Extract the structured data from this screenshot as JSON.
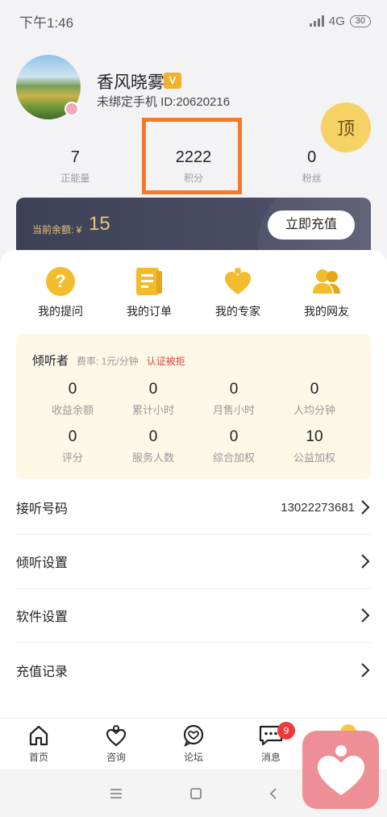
{
  "status_bar": {
    "time": "下午1:46",
    "network": "4G",
    "battery": "30"
  },
  "profile": {
    "name": "香风晓雾",
    "vip_badge": "V",
    "sub_line": "未绑定手机 ID:20620216",
    "top_button": "顶"
  },
  "stats": [
    {
      "value": "7",
      "label": "正能量"
    },
    {
      "value": "2222",
      "label": "积分"
    },
    {
      "value": "0",
      "label": "粉丝"
    }
  ],
  "balance": {
    "label": "当前余额: ¥",
    "value": "15",
    "recharge_button": "立即充值"
  },
  "quick_actions": [
    {
      "label": "我的提问",
      "icon": "question-icon"
    },
    {
      "label": "我的订单",
      "icon": "order-icon"
    },
    {
      "label": "我的专家",
      "icon": "expert-heart-icon"
    },
    {
      "label": "我的网友",
      "icon": "friends-icon"
    }
  ],
  "listener": {
    "title": "倾听者",
    "rate": "费率: 1元/分钟",
    "status": "认证被拒",
    "stats": [
      {
        "value": "0",
        "label": "收益余额"
      },
      {
        "value": "0",
        "label": "累计小时"
      },
      {
        "value": "0",
        "label": "月售小时"
      },
      {
        "value": "0",
        "label": "人均分钟"
      },
      {
        "value": "0",
        "label": "评分"
      },
      {
        "value": "0",
        "label": "服务人数"
      },
      {
        "value": "0",
        "label": "综合加权"
      },
      {
        "value": "10",
        "label": "公益加权"
      }
    ]
  },
  "menu": [
    {
      "label": "接听号码",
      "value": "13022273681"
    },
    {
      "label": "倾听设置",
      "value": ""
    },
    {
      "label": "软件设置",
      "value": ""
    },
    {
      "label": "充值记录",
      "value": ""
    }
  ],
  "tabs": [
    {
      "label": "首页",
      "icon": "home-icon"
    },
    {
      "label": "咨询",
      "icon": "consult-icon"
    },
    {
      "label": "论坛",
      "icon": "forum-icon"
    },
    {
      "label": "消息",
      "icon": "message-icon",
      "badge": "9"
    },
    {
      "label": "",
      "icon": "profile-dot-icon"
    }
  ],
  "colors": {
    "accent_gold": "#e8c678",
    "icon_gold": "#f3bc2c",
    "highlight_box": "#f47a2a",
    "reject_red": "#e04545",
    "badge_red": "#ee3a3a",
    "float_app_pink": "#ee8f96"
  }
}
